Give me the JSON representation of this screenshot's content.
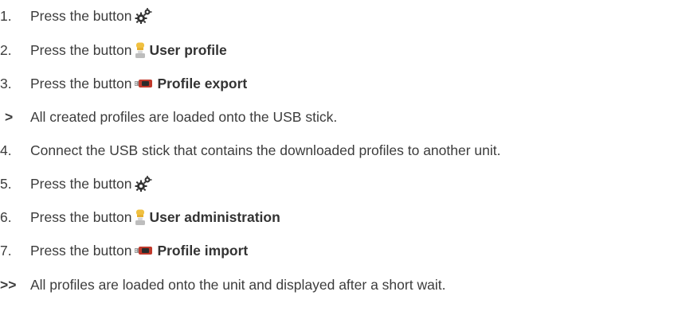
{
  "steps": [
    {
      "marker": "1.",
      "text": "Press the button",
      "icon": "gear-icon",
      "label": ""
    },
    {
      "marker": "2.",
      "text": "Press the button",
      "icon": "chef-icon",
      "label": "User profile"
    },
    {
      "marker": "3.",
      "text": "Press the button",
      "icon": "usb-stick-icon",
      "label": "Profile export"
    },
    {
      "marker": ">",
      "text": "All created profiles are loaded onto the USB stick.",
      "icon": "",
      "label": ""
    },
    {
      "marker": "4.",
      "text": "Connect the USB stick that contains the downloaded profiles to another unit.",
      "icon": "",
      "label": ""
    },
    {
      "marker": "5.",
      "text": "Press the button",
      "icon": "gear-icon",
      "label": ""
    },
    {
      "marker": "6.",
      "text": "Press the button",
      "icon": "chef-icon",
      "label": "User administration"
    },
    {
      "marker": "7.",
      "text": "Press the button",
      "icon": "usb-stick-icon",
      "label": "Profile import"
    },
    {
      "marker": ">>",
      "text": "All profiles are loaded onto the unit and displayed after a short wait.",
      "icon": "",
      "label": ""
    }
  ],
  "colors": {
    "text": "#3c3c3c",
    "chef_hat": "#f0c040",
    "usb_body": "#c0392b"
  }
}
